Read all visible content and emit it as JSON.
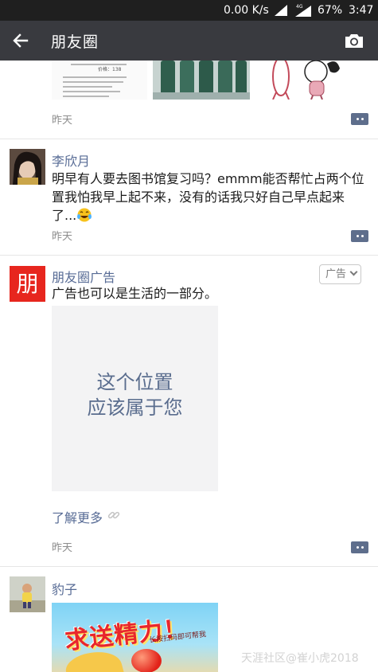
{
  "status_bar": {
    "speed": "0.00 K/s",
    "network": "4G",
    "battery": "67%",
    "time": "3:47"
  },
  "title_bar": {
    "back_icon": "arrow-left-icon",
    "title": "朋友圈",
    "camera_icon": "camera-icon"
  },
  "feed": {
    "posts": [
      {
        "time": "昨天",
        "doc_image_text": "价格：138",
        "comment_icon": "comment-icon"
      },
      {
        "nickname": "李欣月",
        "text": "明早有人要去图书馆复习吗？emmm能否帮忙占两个位置我怕我早上起不来，没有的话我只好自己早点起来了...",
        "emoji": "crying-laughing-emoji",
        "time": "昨天",
        "comment_icon": "comment-icon"
      },
      {
        "avatar_text": "朋",
        "nickname": "朋友圈广告",
        "ad_tag": "广告",
        "text": "广告也可以是生活的一部分。",
        "placeholder_line1": "这个位置",
        "placeholder_line2": "应该属于您",
        "learn_more": "了解更多",
        "time": "昨天",
        "comment_icon": "comment-icon"
      },
      {
        "nickname": "豹子",
        "promo_big_text": "求送精力！",
        "promo_small_text": "长按扫码即可帮我"
      }
    ]
  },
  "watermark": "天涯社区@崔小虎2018",
  "colors": {
    "nickname": "#576b95",
    "title_bar_bg": "#393a3f",
    "status_bar_bg": "#1f1f1f",
    "ad_avatar_bg": "#e7261e"
  }
}
